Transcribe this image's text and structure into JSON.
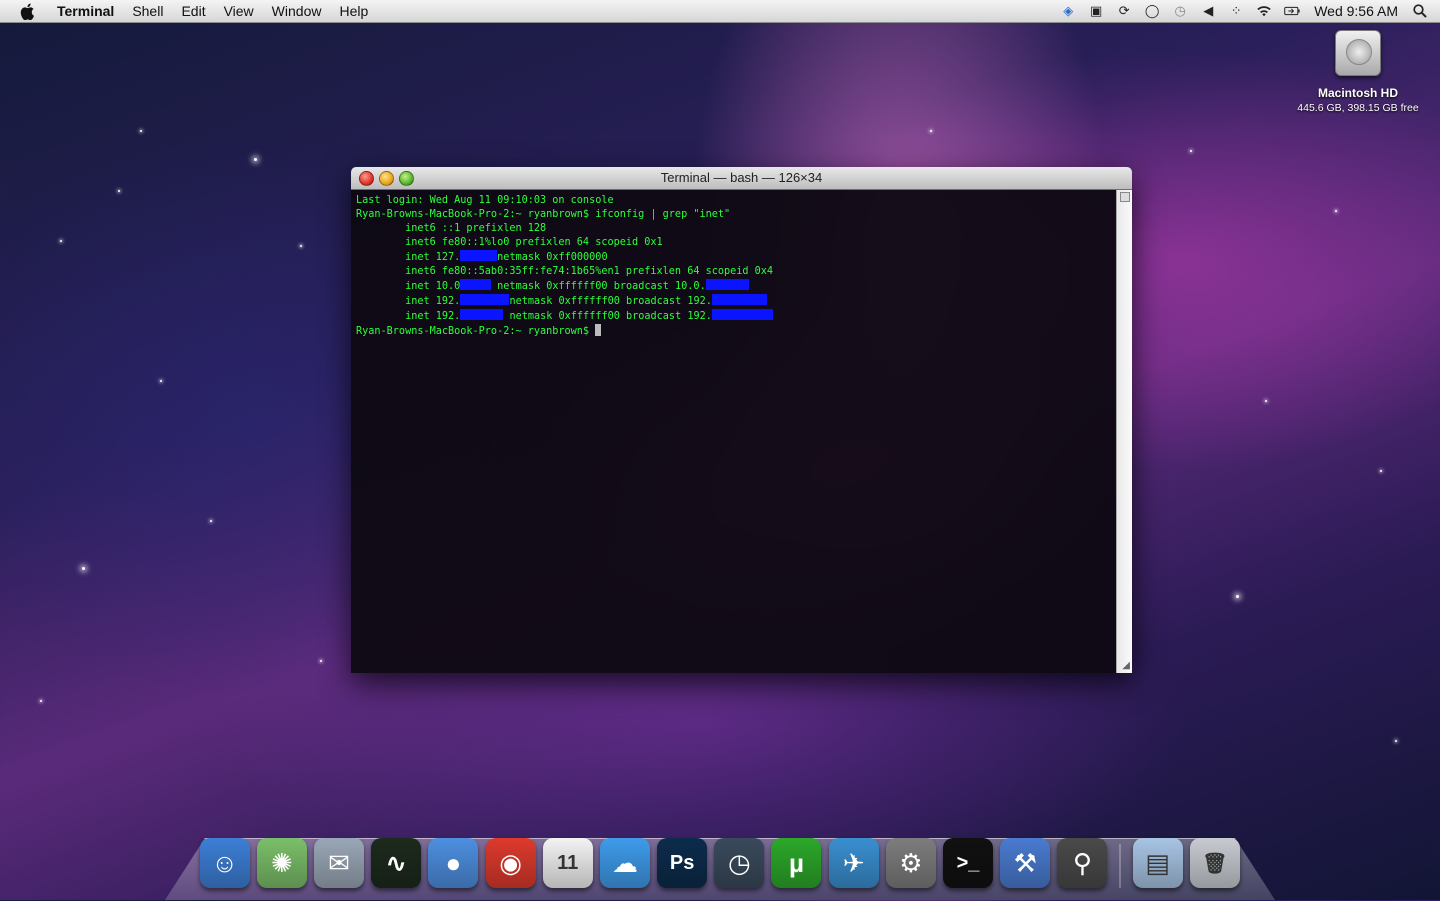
{
  "menubar": {
    "apple_icon": "apple-icon",
    "app_name": "Terminal",
    "menus": [
      "Shell",
      "Edit",
      "View",
      "Window",
      "Help"
    ],
    "status_icons": [
      "dropbox-icon",
      "display-icon",
      "sync-icon",
      "chat-icon",
      "time-machine-icon",
      "volume-icon",
      "bluetooth-icon",
      "wifi-icon",
      "battery-icon"
    ],
    "clock": "Wed 9:56 AM",
    "spotlight_icon": "spotlight-search-icon"
  },
  "desktop": {
    "drive_name": "Macintosh HD",
    "drive_info": "445.6 GB, 398.15 GB free"
  },
  "terminal": {
    "title": "Terminal — bash — 126×34",
    "lines": [
      {
        "parts": [
          {
            "t": "Last login: Wed Aug 11 09:10:03 on console"
          }
        ]
      },
      {
        "parts": [
          {
            "t": "Ryan-Browns-MacBook-Pro-2:~ ryanbrown$ ifconfig | grep \"inet\""
          }
        ]
      },
      {
        "parts": [
          {
            "t": "        inet6 ::1 prefixlen 128"
          }
        ]
      },
      {
        "parts": [
          {
            "t": "        inet6 fe80::1%lo0 prefixlen 64 scopeid 0x1"
          }
        ]
      },
      {
        "parts": [
          {
            "t": "        inet 127."
          },
          {
            "r": 6
          },
          {
            "t": "netmask 0xff000000"
          }
        ]
      },
      {
        "parts": [
          {
            "t": "        inet6 fe80::5ab0:35ff:fe74:1b65%en1 prefixlen 64 scopeid 0x4"
          }
        ]
      },
      {
        "parts": [
          {
            "t": "        inet 10.0"
          },
          {
            "r": 5
          },
          {
            "t": " netmask 0xffffff00 broadcast 10.0."
          },
          {
            "r": 7
          }
        ]
      },
      {
        "parts": [
          {
            "t": "        inet 192."
          },
          {
            "r": 8
          },
          {
            "t": "netmask 0xffffff00 broadcast 192."
          },
          {
            "r": 9
          }
        ]
      },
      {
        "parts": [
          {
            "t": "        inet 192."
          },
          {
            "r": 7
          },
          {
            "t": " netmask 0xffffff00 broadcast 192."
          },
          {
            "r": 10
          }
        ]
      },
      {
        "parts": [
          {
            "t": "Ryan-Browns-MacBook-Pro-2:~ ryanbrown$ "
          },
          {
            "cursor": true
          }
        ]
      }
    ]
  },
  "dock": {
    "items": [
      {
        "name": "finder-icon",
        "glyph": "☺",
        "color": "#3d7fd6"
      },
      {
        "name": "activity-spinner-icon",
        "glyph": "✺",
        "color": "#7bbf6a"
      },
      {
        "name": "mail-icon",
        "glyph": "✉",
        "color": "#9aa7b6"
      },
      {
        "name": "activity-monitor-icon",
        "glyph": "∿",
        "color": "#1d2a1d"
      },
      {
        "name": "ichat-icon",
        "glyph": "●",
        "color": "#4e8fe0"
      },
      {
        "name": "chrome-icon",
        "glyph": "◉",
        "color": "#dd3a2d"
      },
      {
        "name": "ical-icon",
        "glyph": "11",
        "color": "#f3f3f3"
      },
      {
        "name": "cloud-icon",
        "glyph": "☁",
        "color": "#3f9bea"
      },
      {
        "name": "photoshop-icon",
        "glyph": "Ps",
        "color": "#0c2c4c"
      },
      {
        "name": "time-machine-icon",
        "glyph": "◷",
        "color": "#3a4a5c"
      },
      {
        "name": "utorrent-icon",
        "glyph": "µ",
        "color": "#2ca82a"
      },
      {
        "name": "mail-bird-icon",
        "glyph": "✈",
        "color": "#3a8fd0"
      },
      {
        "name": "system-preferences-icon",
        "glyph": "⚙",
        "color": "#7d7d7d"
      },
      {
        "name": "terminal-icon",
        "glyph": ">_",
        "color": "#111"
      },
      {
        "name": "xcode-icon",
        "glyph": "⚒",
        "color": "#4a7bd0"
      },
      {
        "name": "steam-icon",
        "glyph": "⚲",
        "color": "#4a4a4a"
      },
      {
        "name": "downloads-folder-icon",
        "glyph": "▤",
        "color": "#a8c4e4"
      },
      {
        "name": "trash-icon",
        "glyph": "🗑",
        "color": "#c8ccd2"
      }
    ]
  }
}
